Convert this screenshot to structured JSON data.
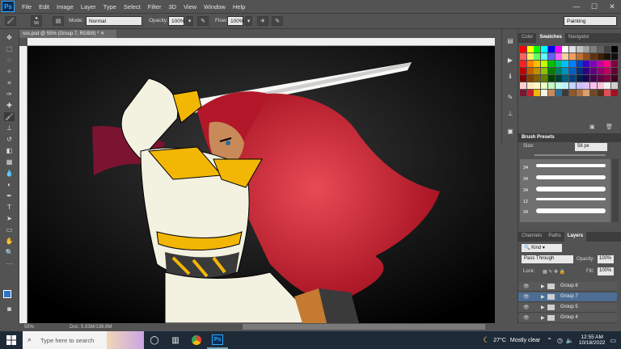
{
  "menubar": {
    "logo": "Ps",
    "items": [
      "File",
      "Edit",
      "Image",
      "Layer",
      "Type",
      "Select",
      "Filter",
      "3D",
      "View",
      "Window",
      "Help"
    ],
    "win_min": "—",
    "win_max": "☐",
    "win_close": "✕"
  },
  "options": {
    "brush_size": "56",
    "mode_label": "Mode:",
    "mode_value": "Normal",
    "opacity_label": "Opacity:",
    "opacity_value": "100%",
    "flow_label": "Flow:",
    "flow_value": "100%",
    "workspace": "Painting"
  },
  "document": {
    "tab_title": "sss.psd @ 55% (Group 7, RGB/8) *",
    "zoom": "55%",
    "doc_info": "Doc: 5.93M/138.6M"
  },
  "panels": {
    "swatch_tabs": [
      "Color",
      "Swatches",
      "Navigator"
    ],
    "brush_presets_title": "Brush Presets",
    "size_label": "Size:",
    "size_value": "56 px",
    "brush_sizes": [
      "34",
      "34",
      "34",
      "12",
      "34",
      "34"
    ],
    "layer_tabs": [
      "Channels",
      "Paths",
      "Layers"
    ],
    "kind_label": "Kind",
    "blend_mode": "Pass Through",
    "opacity_label": "Opacity:",
    "opacity_value": "100%",
    "lock_label": "Lock:",
    "fill_label": "Fill:",
    "fill_value": "100%",
    "layers": [
      {
        "name": "Group 6",
        "selected": false
      },
      {
        "name": "Group 7",
        "selected": true
      },
      {
        "name": "Group 5",
        "selected": false
      },
      {
        "name": "Group 4",
        "selected": false
      }
    ]
  },
  "taskbar": {
    "search_placeholder": "Type here to search",
    "temperature": "27°C",
    "weather": "Mostly clear",
    "time": "12:55 AM",
    "date": "10/18/2022"
  },
  "colors": {
    "selected_layer": "#4d6d93",
    "hair_red": "#c41e2d",
    "armor_cream": "#f3f1e0",
    "armor_gold": "#f2b705",
    "sleeve_maroon": "#7a1430"
  }
}
